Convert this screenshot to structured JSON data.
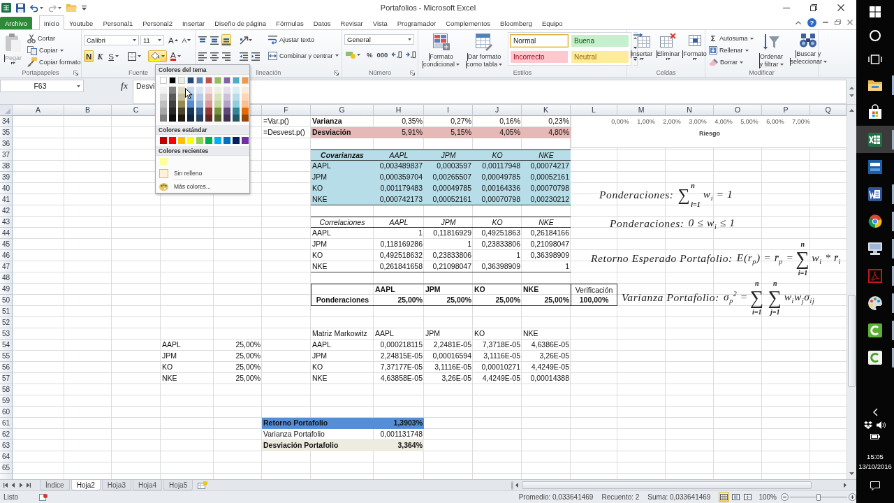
{
  "window": {
    "title": "Portafolios - Microsoft Excel"
  },
  "quick_access": [
    {
      "kind": "save",
      "disabled": false
    },
    {
      "kind": "undo",
      "disabled": false
    },
    {
      "kind": "redo",
      "disabled": true
    },
    {
      "kind": "open",
      "disabled": false
    },
    {
      "kind": "customize",
      "disabled": false
    }
  ],
  "ribbon": {
    "file_tab": "Archivo",
    "tabs": [
      {
        "label": "Inicio",
        "selected": true
      },
      {
        "label": "Youtube",
        "selected": false
      },
      {
        "label": "Personal1",
        "selected": false
      },
      {
        "label": "Personal2",
        "selected": false
      },
      {
        "label": "Insertar",
        "selected": false
      },
      {
        "label": "Diseño de página",
        "selected": false
      },
      {
        "label": "Fórmulas",
        "selected": false
      },
      {
        "label": "Datos",
        "selected": false
      },
      {
        "label": "Revisar",
        "selected": false
      },
      {
        "label": "Vista",
        "selected": false
      },
      {
        "label": "Programador",
        "selected": false
      },
      {
        "label": "Complementos",
        "selected": false
      },
      {
        "label": "Bloomberg",
        "selected": false
      },
      {
        "label": "Equipo",
        "selected": false
      }
    ],
    "help_glyph": "?",
    "clipboard": {
      "label": "Portapapeles",
      "paste": {
        "label": "Pegar",
        "disabled": true
      },
      "commands": [
        {
          "kind": "cut",
          "label": "Cortar",
          "dropdown": false
        },
        {
          "kind": "copy",
          "label": "Copiar",
          "dropdown": true
        },
        {
          "kind": "format-painter",
          "label": "Copiar formato",
          "dropdown": false
        }
      ]
    },
    "font": {
      "label": "Fuente",
      "font_name": "Calibri",
      "font_size": "11",
      "size_buttons": [
        {
          "kind": "grow",
          "glyph": "A"
        },
        {
          "kind": "shrink",
          "glyph": "A"
        }
      ],
      "format_buttons": [
        {
          "kind": "bold",
          "glyph": "N",
          "selected": true,
          "dropdown": false
        },
        {
          "kind": "italic",
          "glyph": "K",
          "selected": false,
          "dropdown": false
        },
        {
          "kind": "underline",
          "glyph": "S",
          "selected": false,
          "dropdown": true
        },
        {
          "kind": "borders",
          "selected": false,
          "dropdown": true
        },
        {
          "kind": "fill",
          "selected": true,
          "dropdown": true
        },
        {
          "kind": "font-color",
          "glyph": "A",
          "selected": false,
          "dropdown": true
        }
      ]
    },
    "alignment": {
      "label": "lineación",
      "vertical": [
        {
          "kind": "top",
          "selected": false
        },
        {
          "kind": "middle",
          "selected": false
        },
        {
          "kind": "bottom",
          "selected": true
        },
        {
          "kind": "orientation",
          "selected": false
        }
      ],
      "horizontal": [
        {
          "kind": "left",
          "selected": false
        },
        {
          "kind": "center",
          "selected": false
        },
        {
          "kind": "right",
          "selected": false
        },
        {
          "kind": "outdent",
          "selected": false
        },
        {
          "kind": "indent",
          "selected": false
        }
      ],
      "wrap": "Ajustar texto",
      "merge": "Combinar y centrar"
    },
    "number": {
      "label": "Número",
      "format": "General",
      "buttons": [
        {
          "kind": "accounting"
        },
        {
          "kind": "percent",
          "glyph": "%"
        },
        {
          "kind": "thousands",
          "glyph": "000"
        },
        {
          "kind": "more-decimals"
        },
        {
          "kind": "fewer-decimals"
        }
      ]
    },
    "styles": {
      "label": "Estilos",
      "commands": [
        {
          "kind": "conditional",
          "lines": [
            "Formato",
            "condicional"
          ]
        },
        {
          "kind": "table",
          "lines": [
            "Dar formato",
            "como tabla"
          ]
        }
      ],
      "gallery": [
        {
          "kind": "normal",
          "label": "Normal",
          "selected": true
        },
        {
          "kind": "good",
          "label": "Buena",
          "selected": false
        },
        {
          "kind": "bad",
          "label": "Incorrecto",
          "selected": false
        },
        {
          "kind": "neutral",
          "label": "Neutral",
          "selected": false
        }
      ]
    },
    "cells": {
      "label": "Celdas",
      "commands": [
        {
          "kind": "insert",
          "label": "Insertar"
        },
        {
          "kind": "delete",
          "label": "Eliminar"
        },
        {
          "kind": "format",
          "label": "Formato"
        }
      ]
    },
    "editing": {
      "label": "Modificar",
      "small": [
        {
          "kind": "autosum",
          "glyph": "Σ",
          "label": "Autosuma"
        },
        {
          "kind": "fill",
          "label": "Rellenar"
        },
        {
          "kind": "clear",
          "label": "Borrar"
        }
      ],
      "large": [
        {
          "kind": "sort",
          "lines": [
            "Ordenar",
            "y filtrar"
          ]
        },
        {
          "kind": "find",
          "lines": [
            "Buscar y",
            "seleccionar"
          ]
        }
      ]
    }
  },
  "formula_bar": {
    "name_box": "F63",
    "function_glyph": "fx",
    "content": "Desvi"
  },
  "fill_color_menu": {
    "theme_title": "Colores del tema",
    "theme_colors": [
      {
        "color": "#ffffff",
        "shades": [
          {
            "color": "#f2f2f2"
          },
          {
            "color": "#d9d9d9"
          },
          {
            "color": "#bfbfbf"
          },
          {
            "color": "#a6a6a6"
          },
          {
            "color": "#808080"
          }
        ]
      },
      {
        "color": "#000000",
        "shades": [
          {
            "color": "#7f7f7f"
          },
          {
            "color": "#595959"
          },
          {
            "color": "#404040"
          },
          {
            "color": "#262626"
          },
          {
            "color": "#0d0d0d"
          }
        ]
      },
      {
        "color": "#eeece1",
        "shades": [
          {
            "color": "#ddd9c3"
          },
          {
            "color": "#c4bd97"
          },
          {
            "color": "#948a54"
          },
          {
            "color": "#4a452a"
          },
          {
            "color": "#1d1b10"
          }
        ]
      },
      {
        "color": "#1f497d",
        "shades": [
          {
            "color": "#c6d9f0"
          },
          {
            "color": "#8db3e2"
          },
          {
            "color": "#548dd4"
          },
          {
            "color": "#17365d"
          },
          {
            "color": "#0f243e"
          }
        ]
      },
      {
        "color": "#4f81bd",
        "shades": [
          {
            "color": "#dbe5f1"
          },
          {
            "color": "#b8cce4"
          },
          {
            "color": "#95b3d7"
          },
          {
            "color": "#366092"
          },
          {
            "color": "#244061"
          }
        ]
      },
      {
        "color": "#c0504d",
        "shades": [
          {
            "color": "#f2dcdb"
          },
          {
            "color": "#e5b9b7"
          },
          {
            "color": "#d99694"
          },
          {
            "color": "#953734"
          },
          {
            "color": "#632423"
          }
        ]
      },
      {
        "color": "#9bbb59",
        "shades": [
          {
            "color": "#ebf1dd"
          },
          {
            "color": "#d7e3bc"
          },
          {
            "color": "#c3d69b"
          },
          {
            "color": "#76923c"
          },
          {
            "color": "#4f6128"
          }
        ]
      },
      {
        "color": "#8064a2",
        "shades": [
          {
            "color": "#e5e0ec"
          },
          {
            "color": "#ccc1d9"
          },
          {
            "color": "#b2a2c7"
          },
          {
            "color": "#5f497a"
          },
          {
            "color": "#3f3151"
          }
        ]
      },
      {
        "color": "#4bacc6",
        "shades": [
          {
            "color": "#dbeef3"
          },
          {
            "color": "#b7dde8"
          },
          {
            "color": "#92cddc"
          },
          {
            "color": "#31859b"
          },
          {
            "color": "#205867"
          }
        ]
      },
      {
        "color": "#f79646",
        "shades": [
          {
            "color": "#fdeada"
          },
          {
            "color": "#fbd5b5"
          },
          {
            "color": "#fac08f"
          },
          {
            "color": "#e36c09"
          },
          {
            "color": "#974806"
          }
        ]
      }
    ],
    "standard_title": "Colores estándar",
    "standard_colors": [
      {
        "color": "#c00000"
      },
      {
        "color": "#ff0000"
      },
      {
        "color": "#ffc000"
      },
      {
        "color": "#ffff00"
      },
      {
        "color": "#92d050"
      },
      {
        "color": "#00b050"
      },
      {
        "color": "#00b0f0"
      },
      {
        "color": "#0070c0"
      },
      {
        "color": "#002060"
      },
      {
        "color": "#7030a0"
      }
    ],
    "recent_title": "Colores recientes",
    "recent_colors": [
      {
        "color": "#ffff99"
      }
    ],
    "items": [
      {
        "kind": "no-fill",
        "label": "Sin relleno"
      },
      {
        "kind": "more-colors",
        "label": "Más colores..."
      }
    ]
  },
  "sheet": {
    "column_headers": [
      "A",
      "B",
      "C",
      "F",
      "G",
      "H",
      "I",
      "J",
      "K",
      "L",
      "M",
      "N",
      "O",
      "P",
      "Q"
    ],
    "row_headers": [
      "34",
      "35",
      "36",
      "37",
      "38",
      "39",
      "40",
      "41",
      "42",
      "43",
      "44",
      "45",
      "46",
      "47",
      "48",
      "49",
      "50",
      "51",
      "52",
      "53",
      "54",
      "55",
      "56",
      "57",
      "58",
      "59",
      "60",
      "61",
      "62",
      "63",
      "64",
      "65"
    ],
    "formula_notes": [
      "=Var.p()",
      "=Desvest.p()"
    ],
    "stats": [
      {
        "label": "Varianza",
        "values": [
          "0,35%",
          "0,27%",
          "0,16%",
          "0,23%"
        ],
        "highlighted": false
      },
      {
        "label": "Desviación",
        "values": [
          "5,91%",
          "5,15%",
          "4,05%",
          "4,80%"
        ],
        "highlighted": true
      }
    ],
    "covariance_table": {
      "title": "Covarianzas",
      "columns": [
        "AAPL",
        "JPM",
        "KO",
        "NKE"
      ],
      "rows": [
        {
          "label": "AAPL",
          "values": [
            "0,003489837",
            "0,0003597",
            "0,00117948",
            "0,00074217"
          ]
        },
        {
          "label": "JPM",
          "values": [
            "0,000359704",
            "0,00265507",
            "0,00049785",
            "0,00052161"
          ]
        },
        {
          "label": "KO",
          "values": [
            "0,001179483",
            "0,00049785",
            "0,00164336",
            "0,00070798"
          ]
        },
        {
          "label": "NKE",
          "values": [
            "0,000742173",
            "0,00052161",
            "0,00070798",
            "0,00230212"
          ]
        }
      ]
    },
    "correlation_table": {
      "title": "Correlaciones",
      "columns": [
        "AAPL",
        "JPM",
        "KO",
        "NKE"
      ],
      "rows": [
        {
          "label": "AAPL",
          "values": [
            "1",
            "0,11816929",
            "0,49251863",
            "0,26184166"
          ]
        },
        {
          "label": "JPM",
          "values": [
            "0,118169286",
            "1",
            "0,23833806",
            "0,21098047"
          ]
        },
        {
          "label": "KO",
          "values": [
            "0,492518632",
            "0,23833806",
            "1",
            "0,36398909"
          ]
        },
        {
          "label": "NKE",
          "values": [
            "0,261841658",
            "0,21098047",
            "0,36398909",
            "1"
          ]
        }
      ]
    },
    "weights_table": {
      "columns": [
        "AAPL",
        "JPM",
        "KO",
        "NKE"
      ],
      "check_label": "Verificación",
      "row_label": "Ponderaciones",
      "values": [
        "25,00%",
        "25,00%",
        "25,00%",
        "25,00%"
      ],
      "check_value": "100,00%"
    },
    "markowitz_matrix": {
      "title": "Matriz Markowitz",
      "columns": [
        "AAPL",
        "JPM",
        "KO",
        "NKE"
      ],
      "rows": [
        {
          "label": "AAPL",
          "values": [
            "0,000218115",
            "2,2481E-05",
            "7,3718E-05",
            "4,6386E-05"
          ]
        },
        {
          "label": "JPM",
          "values": [
            "2,24815E-05",
            "0,00016594",
            "3,1116E-05",
            "3,26E-05"
          ]
        },
        {
          "label": "KO",
          "values": [
            "7,37177E-05",
            "3,1116E-05",
            "0,00010271",
            "4,4249E-05"
          ]
        },
        {
          "label": "NKE",
          "values": [
            "4,63858E-05",
            "3,26E-05",
            "4,4249E-05",
            "0,00014388"
          ]
        }
      ]
    },
    "weights_list": [
      {
        "ticker": "AAPL",
        "weight": "25,00%"
      },
      {
        "ticker": "JPM",
        "weight": "25,00%"
      },
      {
        "ticker": "KO",
        "weight": "25,00%"
      },
      {
        "ticker": "NKE",
        "weight": "25,00%"
      }
    ],
    "summary": [
      {
        "label": "Retorno Portafolio",
        "value": "1,3903%",
        "bold": true,
        "color": "#558ed5"
      },
      {
        "label": "Varianza Portafolio",
        "value": "0,001131748",
        "bold": false
      },
      {
        "label": "Desviación Portafolio",
        "value": "3,364%",
        "bold": true,
        "color": "#eeece1"
      }
    ],
    "chart": {
      "axis_labels": [
        "0,00%",
        "1,00%",
        "2,00%",
        "3,00%",
        "4,00%",
        "5,00%",
        "6,00%",
        "7,00%"
      ],
      "axis_title": "Riesgo"
    },
    "equations": [
      {
        "label": "Ponderaciones:",
        "terms": [
          {
            "kind": "inline-sum",
            "symbol": "∑",
            "upper": "n",
            "lower": "i=1"
          },
          {
            "kind": "text",
            "text": "w$_{i}$ = 1"
          }
        ]
      },
      {
        "label": "Ponderaciones:",
        "terms": [
          {
            "kind": "text",
            "text": "0 ≤ w$_{i}$ ≤ 1"
          }
        ]
      },
      {
        "label": "Retorno Esperado Portafolio:",
        "terms": [
          {
            "kind": "text",
            "text": "E(r$_{p}$) = r̄$_{p}$ ="
          },
          {
            "kind": "sum",
            "symbol": "∑",
            "upper": "n",
            "lower": "i=1"
          },
          {
            "kind": "text",
            "text": "w$_{i}$ * r̄$_{i}$"
          }
        ]
      },
      {
        "label": "Varianza Portafolio:",
        "terms": [
          {
            "kind": "text",
            "text": "σ$_{p}$$^{2}$ ="
          },
          {
            "kind": "sum",
            "symbol": "∑",
            "upper": "n",
            "lower": "i=1"
          },
          {
            "kind": "sum",
            "symbol": "∑",
            "upper": "n",
            "lower": "j=1"
          },
          {
            "kind": "text",
            "text": "w$_{i}$w$_{j}$σ$_{ij}$"
          }
        ]
      }
    ]
  },
  "sheet_tabs": [
    {
      "label": "Índice",
      "selected": false
    },
    {
      "label": "Hoja2",
      "selected": true
    },
    {
      "label": "Hoja3",
      "selected": false
    },
    {
      "label": "Hoja4",
      "selected": false
    },
    {
      "label": "Hoja5",
      "selected": false
    }
  ],
  "status_bar": {
    "status": "Listo",
    "aggregates": [
      "Promedio: 0,033641469",
      "Recuento: 2",
      "Suma: 0,033641469"
    ],
    "views": [
      {
        "kind": "normal",
        "selected": true
      },
      {
        "kind": "page-layout",
        "selected": false
      },
      {
        "kind": "page-break",
        "selected": false
      }
    ],
    "zoom": {
      "label": "100%",
      "level": 0.5
    }
  },
  "taskbar": {
    "apps": [
      {
        "kind": "folder",
        "selected": false,
        "running": true
      },
      {
        "kind": "store",
        "selected": false,
        "running": false
      },
      {
        "kind": "spreadsheet",
        "selected": true,
        "running": true
      },
      {
        "kind": "dev",
        "selected": false,
        "running": false
      },
      {
        "kind": "word",
        "selected": false,
        "running": true
      },
      {
        "kind": "browser",
        "selected": false,
        "running": true
      },
      {
        "kind": "computer",
        "selected": false,
        "running": true
      },
      {
        "kind": "pdf",
        "selected": false,
        "running": true
      },
      {
        "kind": "palette",
        "selected": false,
        "running": true
      },
      {
        "kind": "recorder",
        "selected": false,
        "running": true
      },
      {
        "kind": "recorder-light",
        "selected": false,
        "running": true
      }
    ],
    "time": "15:05",
    "date": "13/10/2016"
  }
}
